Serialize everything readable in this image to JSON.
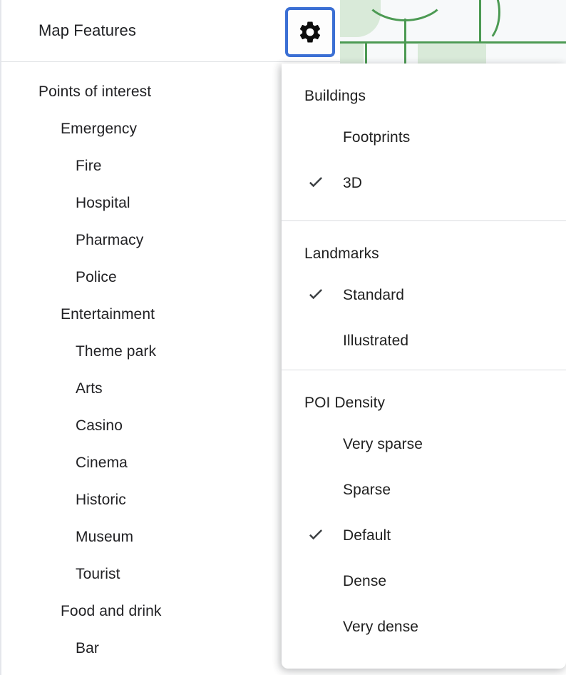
{
  "panel": {
    "title": "Map Features",
    "settings_button": {
      "icon": "gear-icon",
      "focus_ring_color": "#3b6fd4"
    },
    "tree": [
      {
        "label": "Points of interest",
        "level": 0
      },
      {
        "label": "Emergency",
        "level": 1
      },
      {
        "label": "Fire",
        "level": 2
      },
      {
        "label": "Hospital",
        "level": 2
      },
      {
        "label": "Pharmacy",
        "level": 2
      },
      {
        "label": "Police",
        "level": 2
      },
      {
        "label": "Entertainment",
        "level": 1
      },
      {
        "label": "Theme park",
        "level": 2
      },
      {
        "label": "Arts",
        "level": 2
      },
      {
        "label": "Casino",
        "level": 2
      },
      {
        "label": "Cinema",
        "level": 2
      },
      {
        "label": "Historic",
        "level": 2
      },
      {
        "label": "Museum",
        "level": 2
      },
      {
        "label": "Tourist",
        "level": 2
      },
      {
        "label": "Food and drink",
        "level": 1
      },
      {
        "label": "Bar",
        "level": 2
      }
    ]
  },
  "menu": {
    "sections": [
      {
        "header": "Buildings",
        "items": [
          {
            "label": "Footprints",
            "checked": false
          },
          {
            "label": "3D",
            "checked": true
          }
        ]
      },
      {
        "header": "Landmarks",
        "items": [
          {
            "label": "Standard",
            "checked": true
          },
          {
            "label": "Illustrated",
            "checked": false
          }
        ]
      },
      {
        "header": "POI Density",
        "items": [
          {
            "label": "Very sparse",
            "checked": false
          },
          {
            "label": "Sparse",
            "checked": false
          },
          {
            "label": "Default",
            "checked": true
          },
          {
            "label": "Dense",
            "checked": false
          },
          {
            "label": "Very dense",
            "checked": false
          }
        ]
      }
    ],
    "check_glyph": "check-icon"
  },
  "map": {
    "road_color": "#4c9a53",
    "park_color": "#d9ead9",
    "base_color": "#f7f9fa"
  }
}
